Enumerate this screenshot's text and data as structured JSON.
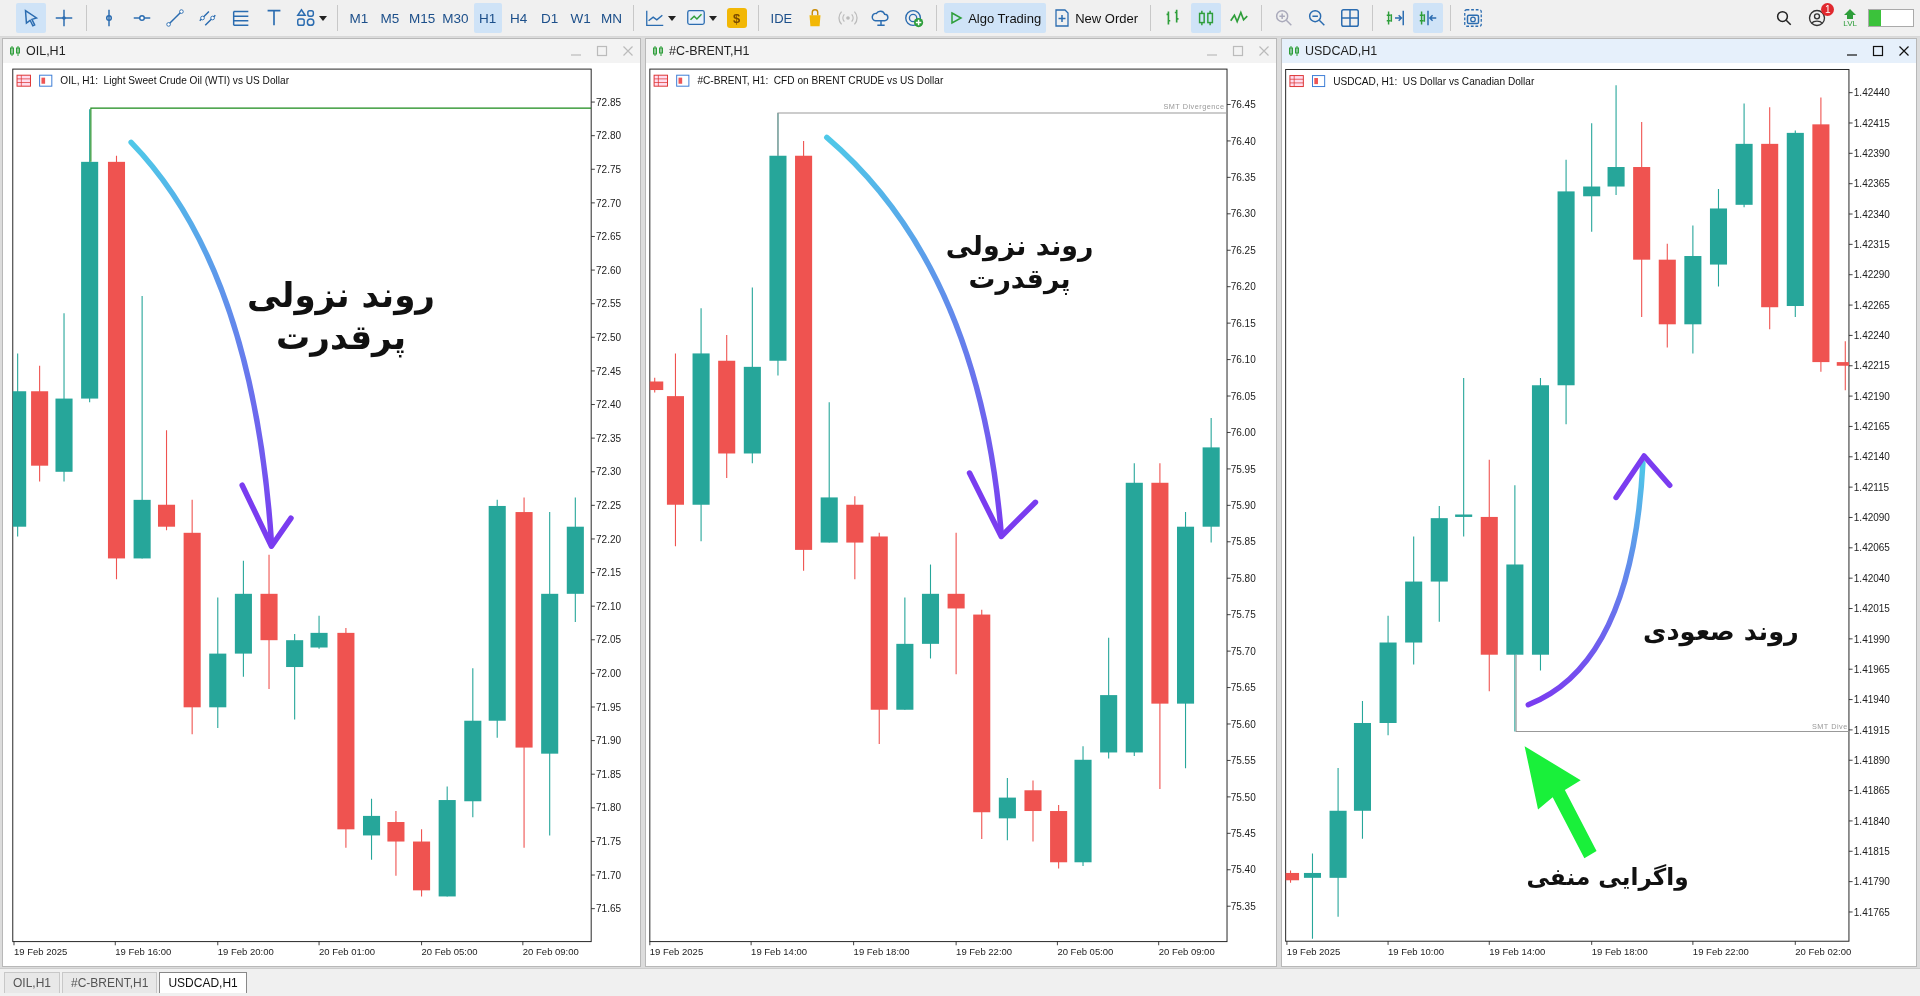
{
  "toolbar": {
    "items": [
      {
        "kind": "icon",
        "selected": true
      },
      {
        "kind": "icon",
        "selected": false
      },
      {
        "kind": "separator"
      },
      {
        "kind": "icon",
        "selected": false
      },
      {
        "kind": "icon",
        "selected": false
      },
      {
        "kind": "icon",
        "selected": false
      },
      {
        "kind": "icon",
        "selected": false
      },
      {
        "kind": "icon",
        "selected": false
      },
      {
        "kind": "icon",
        "selected": false
      },
      {
        "kind": "icon",
        "selected": false
      },
      {
        "kind": "separator"
      },
      {
        "kind": "timeframe",
        "label": "M1",
        "selected": false
      },
      {
        "kind": "timeframe",
        "label": "M5",
        "selected": false
      },
      {
        "kind": "timeframe",
        "label": "M15",
        "selected": false
      },
      {
        "kind": "timeframe",
        "label": "M30",
        "selected": false
      },
      {
        "kind": "timeframe",
        "label": "H1",
        "selected": true
      },
      {
        "kind": "timeframe",
        "label": "H4",
        "selected": false
      },
      {
        "kind": "timeframe",
        "label": "D1",
        "selected": false
      },
      {
        "kind": "timeframe",
        "label": "W1",
        "selected": false
      },
      {
        "kind": "timeframe",
        "label": "MN",
        "selected": false
      },
      {
        "kind": "separator"
      },
      {
        "kind": "icon",
        "selected": false
      },
      {
        "kind": "icon",
        "selected": false
      },
      {
        "kind": "coin",
        "label": "$"
      },
      {
        "kind": "separator"
      },
      {
        "kind": "button",
        "label": "IDE"
      },
      {
        "kind": "icon",
        "selected": false
      },
      {
        "kind": "icon",
        "selected": false
      },
      {
        "kind": "icon",
        "selected": false
      },
      {
        "kind": "icon",
        "selected": false
      },
      {
        "kind": "separator"
      },
      {
        "kind": "button",
        "label": "Algo Trading",
        "selected": true
      },
      {
        "kind": "button",
        "label": "New Order",
        "selected": false
      },
      {
        "kind": "separator"
      },
      {
        "kind": "icon",
        "selected": false
      },
      {
        "kind": "icon",
        "selected": true
      },
      {
        "kind": "icon",
        "selected": false
      },
      {
        "kind": "separator"
      },
      {
        "kind": "icon",
        "selected": false
      },
      {
        "kind": "icon",
        "selected": false
      },
      {
        "kind": "icon",
        "selected": false
      },
      {
        "kind": "separator"
      },
      {
        "kind": "icon",
        "selected": false
      },
      {
        "kind": "icon",
        "selected": true
      },
      {
        "kind": "separator"
      },
      {
        "kind": "icon",
        "selected": false
      }
    ],
    "notification_count": "1",
    "level_label": "LVL"
  },
  "windows": [
    {
      "title": "OIL,H1",
      "active": false,
      "header": "OIL, H1:  Light Sweet Crude Oil (WTI) vs US Dollar",
      "price_labels": [
        "72.85",
        "72.80",
        "72.75",
        "72.70",
        "72.65",
        "72.60",
        "72.55",
        "72.50",
        "72.45",
        "72.40",
        "72.35",
        "72.30",
        "72.25",
        "72.20",
        "72.15",
        "72.10",
        "72.05",
        "72.00",
        "71.95",
        "71.90",
        "71.85",
        "71.80",
        "71.75",
        "71.70",
        "71.65"
      ],
      "time_labels": [
        "19 Feb 2025",
        "19 Feb 16:00",
        "19 Feb 20:00",
        "20 Feb 01:00",
        "20 Feb 05:00",
        "20 Feb 09:00"
      ],
      "annotations": [
        {
          "lines": [
            "روند نزولی",
            "پرقدرت"
          ]
        }
      ]
    },
    {
      "title": "#C-BRENT,H1",
      "active": false,
      "header": "#C-BRENT, H1:  CFD on BRENT CRUDE vs US Dollar",
      "indicator_label": "SMT Divergence",
      "price_labels": [
        "76.45",
        "76.40",
        "76.35",
        "76.30",
        "76.25",
        "76.20",
        "76.15",
        "76.10",
        "76.05",
        "76.00",
        "75.95",
        "75.90",
        "75.85",
        "75.80",
        "75.75",
        "75.70",
        "75.65",
        "75.60",
        "75.55",
        "75.50",
        "75.45",
        "75.40",
        "75.35"
      ],
      "time_labels": [
        "19 Feb 2025",
        "19 Feb 14:00",
        "19 Feb 18:00",
        "19 Feb 22:00",
        "20 Feb 05:00",
        "20 Feb 09:00"
      ],
      "annotations": [
        {
          "lines": [
            "روند نزولی",
            "پرقدرت"
          ]
        }
      ]
    },
    {
      "title": "USDCAD,H1",
      "active": true,
      "header": "USDCAD, H1:  US Dollar vs Canadian Dollar",
      "indicator_label": "SMT Dive",
      "price_labels": [
        "1.42440",
        "1.42415",
        "1.42390",
        "1.42365",
        "1.42340",
        "1.42315",
        "1.42290",
        "1.42265",
        "1.42240",
        "1.42215",
        "1.42190",
        "1.42165",
        "1.42140",
        "1.42115",
        "1.42090",
        "1.42065",
        "1.42040",
        "1.42015",
        "1.41990",
        "1.41965",
        "1.41940",
        "1.41915",
        "1.41890",
        "1.41865",
        "1.41840",
        "1.41815",
        "1.41790",
        "1.41765"
      ],
      "time_labels": [
        "19 Feb 2025",
        "19 Feb 10:00",
        "19 Feb 14:00",
        "19 Feb 18:00",
        "19 Feb 22:00",
        "20 Feb 02:00"
      ],
      "annotations": [
        {
          "lines": [
            "روند صعودی"
          ]
        },
        {
          "lines": [
            "واگرایی منفی"
          ]
        }
      ]
    }
  ],
  "tabs": [
    {
      "label": "OIL,H1",
      "selected": false
    },
    {
      "label": "#C-BRENT,H1",
      "selected": false
    },
    {
      "label": "USDCAD,H1",
      "selected": true
    }
  ]
}
